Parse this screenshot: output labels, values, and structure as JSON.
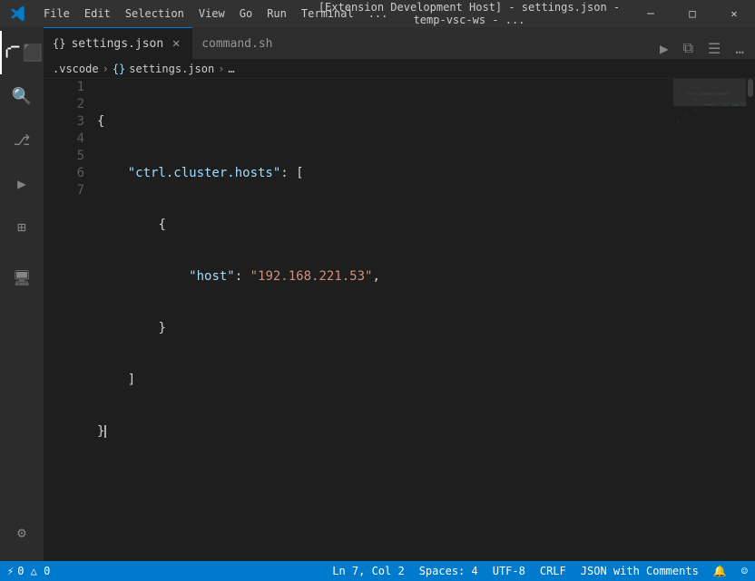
{
  "titleBar": {
    "title": "[Extension Development Host] - settings.json - temp-vsc-ws - ...",
    "menu": [
      "File",
      "Edit",
      "Selection",
      "View",
      "Go",
      "Run",
      "Terminal",
      "..."
    ]
  },
  "windowControls": {
    "minimize": "─",
    "maximize": "□",
    "close": "✕"
  },
  "tabs": [
    {
      "id": "settings",
      "label": "settings.json",
      "icon": "{}",
      "active": true,
      "showClose": true
    },
    {
      "id": "command",
      "label": "command.sh",
      "icon": "",
      "active": false,
      "showClose": false
    }
  ],
  "tabBarButtons": [
    "▶",
    "⧉",
    "☰",
    "…"
  ],
  "breadcrumb": {
    "parts": [
      ".vscode",
      "settings.json",
      "…"
    ]
  },
  "editor": {
    "lines": [
      {
        "num": 1,
        "content": [
          {
            "t": "brace",
            "v": "{"
          }
        ]
      },
      {
        "num": 2,
        "content": [
          {
            "t": "key",
            "v": "    \"ctrl.cluster.hosts\""
          },
          {
            "t": "colon",
            "v": ": "
          },
          {
            "t": "bracket",
            "v": "["
          }
        ]
      },
      {
        "num": 3,
        "content": [
          {
            "t": "brace",
            "v": "        {"
          }
        ]
      },
      {
        "num": 4,
        "content": [
          {
            "t": "key",
            "v": "            \"host\""
          },
          {
            "t": "colon",
            "v": ": "
          },
          {
            "t": "string",
            "v": "\"192.168.221.53\""
          },
          {
            "t": "comma",
            "v": ","
          }
        ]
      },
      {
        "num": 5,
        "content": [
          {
            "t": "brace",
            "v": "        }"
          }
        ]
      },
      {
        "num": 6,
        "content": [
          {
            "t": "bracket",
            "v": "    ]"
          }
        ]
      },
      {
        "num": 7,
        "content": [
          {
            "t": "brace",
            "v": "}"
          }
        ]
      }
    ]
  },
  "statusBar": {
    "left": [
      {
        "id": "remote",
        "icon": "⚡",
        "label": "0 △ 0"
      },
      {
        "id": "errors",
        "icon": "",
        "label": ""
      }
    ],
    "right": [
      {
        "id": "position",
        "label": "Ln 7, Col 2"
      },
      {
        "id": "spaces",
        "label": "Spaces: 4"
      },
      {
        "id": "encoding",
        "label": "UTF-8"
      },
      {
        "id": "eol",
        "label": "CRLF"
      },
      {
        "id": "language",
        "label": "JSON with Comments"
      },
      {
        "id": "notifications",
        "label": "🔔"
      },
      {
        "id": "feedback",
        "label": "☺"
      }
    ]
  },
  "activityBar": {
    "items": [
      {
        "id": "explorer",
        "icon": "files",
        "active": true
      },
      {
        "id": "search",
        "icon": "search"
      },
      {
        "id": "source-control",
        "icon": "scm"
      },
      {
        "id": "run",
        "icon": "run"
      },
      {
        "id": "extensions",
        "icon": "extensions"
      },
      {
        "id": "remote",
        "icon": "remote"
      }
    ],
    "bottom": [
      {
        "id": "settings",
        "icon": "gear"
      }
    ]
  }
}
